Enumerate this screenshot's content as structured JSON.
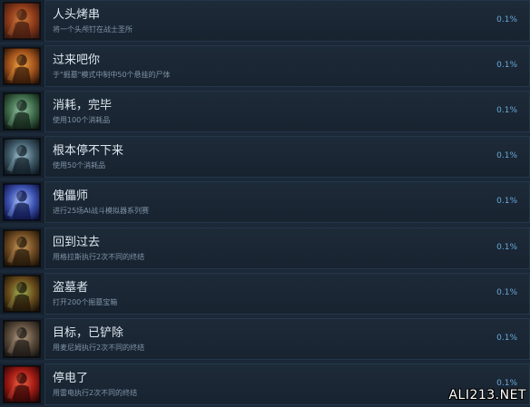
{
  "achievements": [
    {
      "title": "人头烤串",
      "description": "将一个头颅钉在战士圣所",
      "percent": "0.1%",
      "icon": "skull-spike-icon",
      "colors": [
        "#3a1a10",
        "#8c3a1a",
        "#d07a3a"
      ]
    },
    {
      "title": "过来吧你",
      "description": "于\"掘墓\"模式中制中50个悬挂的尸体",
      "percent": "0.1%",
      "icon": "hanging-corpse-icon",
      "colors": [
        "#2a1408",
        "#a0521c",
        "#f0a040"
      ]
    },
    {
      "title": "消耗，完毕",
      "description": "使用100个消耗品",
      "percent": "0.1%",
      "icon": "consumable-icon",
      "colors": [
        "#0f1c14",
        "#3f6b4a",
        "#8fc0a0"
      ]
    },
    {
      "title": "根本停不下来",
      "description": "使用50个消耗品",
      "percent": "0.1%",
      "icon": "consumable-stack-icon",
      "colors": [
        "#101a22",
        "#3e5866",
        "#9cc0cf"
      ]
    },
    {
      "title": "傀儡师",
      "description": "进行25场AI战斗模拟器系列赛",
      "percent": "0.1%",
      "icon": "puppet-master-icon",
      "colors": [
        "#0c1240",
        "#3d52b0",
        "#a8c4ff"
      ]
    },
    {
      "title": "回到过去",
      "description": "用格拉斯执行2次不同的终结",
      "percent": "0.1%",
      "icon": "armored-warrior-icon",
      "colors": [
        "#1e1408",
        "#6e4a22",
        "#c89658"
      ]
    },
    {
      "title": "盗墓者",
      "description": "打开200个掘墓宝箱",
      "percent": "0.1%",
      "icon": "treasure-chest-icon",
      "colors": [
        "#1a1208",
        "#6a4c1c",
        "#9ab050"
      ]
    },
    {
      "title": "目标，已铲除",
      "description": "用麦尼姆执行2次不同的终结",
      "percent": "0.1%",
      "icon": "soldier-icon",
      "colors": [
        "#181614",
        "#5a4a3a",
        "#b09a80"
      ]
    },
    {
      "title": "停电了",
      "description": "用雷电执行2次不同的终结",
      "percent": "0.1%",
      "icon": "lightning-fighter-icon",
      "colors": [
        "#2a0606",
        "#a01a14",
        "#f06040"
      ]
    }
  ],
  "watermark": "ALI213.NET"
}
